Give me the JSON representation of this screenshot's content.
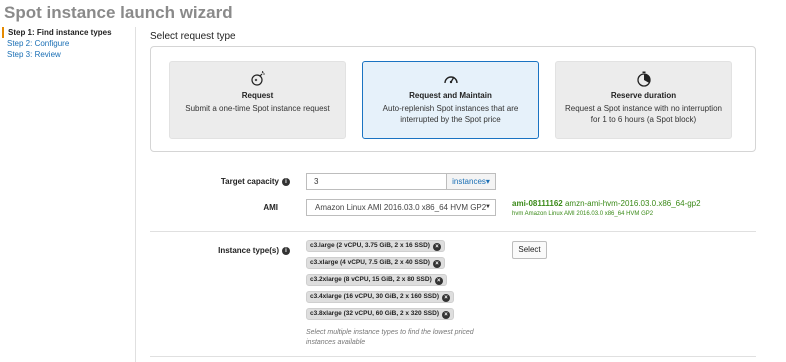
{
  "page_title": "Spot instance launch wizard",
  "steps": [
    {
      "label": "Step 1: Find instance types",
      "active": true
    },
    {
      "label": "Step 2: Configure",
      "active": false
    },
    {
      "label": "Step 3: Review",
      "active": false
    }
  ],
  "request_type": {
    "heading": "Select request type",
    "selected_index": 1,
    "cards": [
      {
        "title": "Request",
        "description": "Submit a one-time Spot instance request",
        "icon": "bomb-icon"
      },
      {
        "title": "Request and Maintain",
        "description": "Auto-replenish Spot instances that are interrupted by the Spot price",
        "icon": "gauge-icon"
      },
      {
        "title": "Reserve duration",
        "description": "Request a Spot instance with no interruption for 1 to 6 hours (a Spot block)",
        "icon": "timer-icon"
      }
    ]
  },
  "target_capacity": {
    "label": "Target capacity",
    "value": "3",
    "unit": "instances"
  },
  "ami": {
    "label": "AMI",
    "selected": "Amazon Linux AMI 2016.03.0 x86_64 HVM GP2",
    "id": "ami-08111162",
    "name": "amzn-ami-hvm-2016.03.0.x86_64-gp2",
    "description": "hvm Amazon Linux AMI 2016.03.0 x86_64 HVM GP2"
  },
  "instance_types": {
    "label": "Instance type(s)",
    "items": [
      "c3.large (2 vCPU, 3.75 GiB, 2 x 16 SSD)",
      "c3.xlarge (4 vCPU, 7.5 GiB, 2 x 40 SSD)",
      "c3.2xlarge (8 vCPU, 15 GiB, 2 x 80 SSD)",
      "c3.4xlarge (16 vCPU, 30 GiB, 2 x 160 SSD)",
      "c3.8xlarge (32 vCPU, 60 GiB, 2 x 320 SSD)"
    ],
    "hint": "Select multiple instance types to find the lowest priced instances available",
    "select_button": "Select"
  },
  "colors": {
    "accent": "#1a73c2",
    "active_step": "#e58a00",
    "ami_green": "#3a8a18"
  }
}
